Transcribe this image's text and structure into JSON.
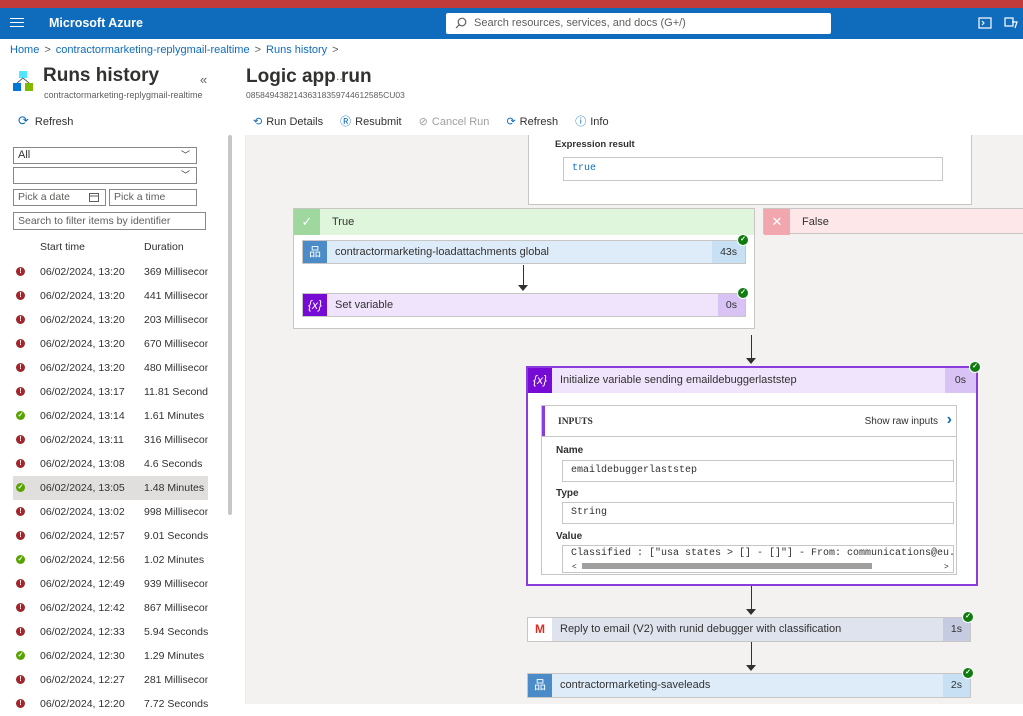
{
  "topbar": {
    "brand": "Microsoft Azure",
    "search_placeholder": "Search resources, services, and docs (G+/)"
  },
  "breadcrumb": {
    "items": [
      "Home",
      "contractormarketing-replygmail-realtime",
      "Runs history"
    ]
  },
  "left": {
    "title": "Runs history",
    "subtitle": "contractormarketing-replygmail-realtime",
    "refresh": "Refresh",
    "status_filter": "All",
    "second_filter": "",
    "date_placeholder": "Pick a date",
    "time_placeholder": "Pick a time",
    "search_placeholder": "Search to filter items by identifier",
    "col_start": "Start time",
    "col_duration": "Duration",
    "runs": [
      {
        "status": "failed",
        "start": "06/02/2024, 13:20",
        "duration": "369 Millisecond"
      },
      {
        "status": "failed",
        "start": "06/02/2024, 13:20",
        "duration": "441 Millisecond"
      },
      {
        "status": "failed",
        "start": "06/02/2024, 13:20",
        "duration": "203 Millisecond"
      },
      {
        "status": "failed",
        "start": "06/02/2024, 13:20",
        "duration": "670 Millisecond"
      },
      {
        "status": "failed",
        "start": "06/02/2024, 13:20",
        "duration": "480 Millisecond"
      },
      {
        "status": "failed",
        "start": "06/02/2024, 13:17",
        "duration": "11.81 Seconds"
      },
      {
        "status": "succeeded",
        "start": "06/02/2024, 13:14",
        "duration": "1.61 Minutes"
      },
      {
        "status": "failed",
        "start": "06/02/2024, 13:11",
        "duration": "316 Millisecond"
      },
      {
        "status": "failed",
        "start": "06/02/2024, 13:08",
        "duration": "4.6 Seconds"
      },
      {
        "status": "succeeded",
        "start": "06/02/2024, 13:05",
        "duration": "1.48 Minutes"
      },
      {
        "status": "failed",
        "start": "06/02/2024, 13:02",
        "duration": "998 Millisecond"
      },
      {
        "status": "failed",
        "start": "06/02/2024, 12:57",
        "duration": "9.01 Seconds"
      },
      {
        "status": "succeeded",
        "start": "06/02/2024, 12:56",
        "duration": "1.02 Minutes"
      },
      {
        "status": "failed",
        "start": "06/02/2024, 12:49",
        "duration": "939 Millisecond"
      },
      {
        "status": "failed",
        "start": "06/02/2024, 12:42",
        "duration": "867 Millisecond"
      },
      {
        "status": "failed",
        "start": "06/02/2024, 12:33",
        "duration": "5.94 Seconds"
      },
      {
        "status": "succeeded",
        "start": "06/02/2024, 12:30",
        "duration": "1.29 Minutes"
      },
      {
        "status": "failed",
        "start": "06/02/2024, 12:27",
        "duration": "281 Millisecond"
      },
      {
        "status": "failed",
        "start": "06/02/2024, 12:20",
        "duration": "7.72 Seconds"
      }
    ]
  },
  "right": {
    "title": "Logic app run",
    "more": "...",
    "run_id": "08584943821436318359744612585CU03",
    "toolbar": {
      "run_details": "Run Details",
      "resubmit": "Resubmit",
      "cancel_run": "Cancel Run",
      "refresh": "Refresh",
      "info": "Info"
    },
    "expression": {
      "label": "Expression result",
      "value": "true"
    },
    "branch_true": "True",
    "branch_false": "False",
    "actions": {
      "loadattachments": {
        "label": "contractormarketing-loadattachments global",
        "duration": "43s"
      },
      "set_variable": {
        "label": "Set variable",
        "duration": "0s"
      },
      "init_variable": {
        "label": "Initialize variable sending emaildebuggerlaststep",
        "duration": "0s"
      },
      "reply_email": {
        "label": "Reply to email (V2) with runid debugger with classification",
        "duration": "1s"
      },
      "saveleads": {
        "label": "contractormarketing-saveleads",
        "duration": "2s"
      }
    },
    "inputs": {
      "heading": "INPUTS",
      "show_raw": "Show raw inputs",
      "name_label": "Name",
      "name_value": "emaildebuggerlaststep",
      "type_label": "Type",
      "type_value": "String",
      "value_label": "Value",
      "value_value": "Classified : [\"usa states > [] - []\"] - From: communications@eu.manageer"
    }
  },
  "colors": {
    "azure_blue": "#0f6cbd",
    "success": "#107c10",
    "failed": "#a4262c",
    "variable_purple": "#8a3ddb"
  }
}
